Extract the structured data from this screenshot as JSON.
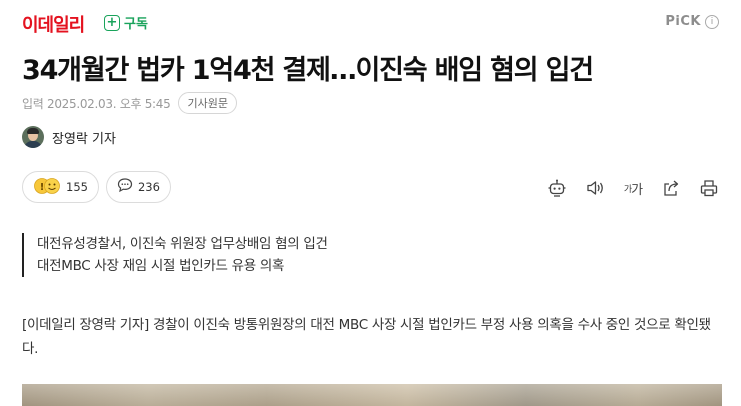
{
  "header": {
    "logo_text": "이데일리",
    "subscribe_label": "구독",
    "pick_label": "PiCK",
    "pick_info": "i"
  },
  "article": {
    "title": "34개월간 법카 1억4천 결제…이진숙 배임 혐의 입건",
    "meta_text": "입력 2025.02.03. 오후 5:45",
    "source_button": "기사원문",
    "author_name": "장영락 기자",
    "summary": [
      "대전유성경찰서, 이진숙 위원장 업무상배임 혐의 입건",
      "대전MBC 사장 재임 시절 법인카드 유용 의혹"
    ],
    "body_first": "[이데일리 장영락 기자] 경찰이 이진숙 방통위원장의 대전 MBC 사장 시절 법인카드 부정 사용 의혹을 수사 중인 것으로 확인됐다."
  },
  "reactions": {
    "reaction_count": "155",
    "comment_count": "236"
  },
  "toolbar": {
    "font_label_small": "가",
    "font_label_large": "가"
  },
  "colors": {
    "brand_red": "#e4121f",
    "subscribe_green": "#19a35b"
  },
  "icons": [
    "plus-icon",
    "info-icon",
    "reaction-emoji-icon",
    "comment-icon",
    "summary-bot-icon",
    "speaker-icon",
    "font-size-icon",
    "share-icon",
    "print-icon"
  ]
}
